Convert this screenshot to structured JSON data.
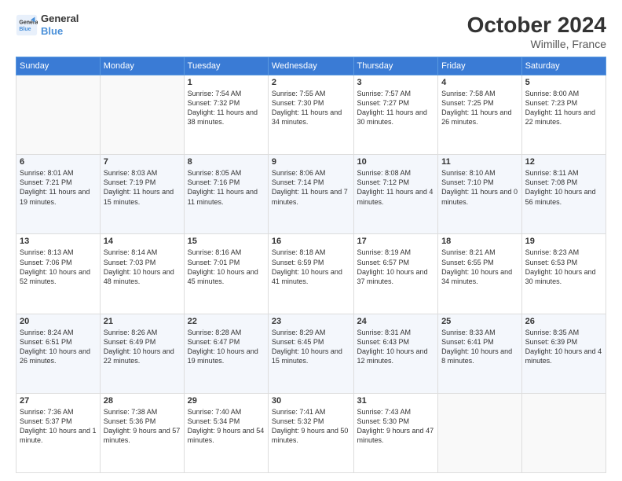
{
  "logo": {
    "line1": "General",
    "line2": "Blue"
  },
  "header": {
    "month": "October 2024",
    "location": "Wimille, France"
  },
  "weekdays": [
    "Sunday",
    "Monday",
    "Tuesday",
    "Wednesday",
    "Thursday",
    "Friday",
    "Saturday"
  ],
  "weeks": [
    [
      {
        "day": "",
        "info": ""
      },
      {
        "day": "",
        "info": ""
      },
      {
        "day": "1",
        "info": "Sunrise: 7:54 AM\nSunset: 7:32 PM\nDaylight: 11 hours\nand 38 minutes."
      },
      {
        "day": "2",
        "info": "Sunrise: 7:55 AM\nSunset: 7:30 PM\nDaylight: 11 hours\nand 34 minutes."
      },
      {
        "day": "3",
        "info": "Sunrise: 7:57 AM\nSunset: 7:27 PM\nDaylight: 11 hours\nand 30 minutes."
      },
      {
        "day": "4",
        "info": "Sunrise: 7:58 AM\nSunset: 7:25 PM\nDaylight: 11 hours\nand 26 minutes."
      },
      {
        "day": "5",
        "info": "Sunrise: 8:00 AM\nSunset: 7:23 PM\nDaylight: 11 hours\nand 22 minutes."
      }
    ],
    [
      {
        "day": "6",
        "info": "Sunrise: 8:01 AM\nSunset: 7:21 PM\nDaylight: 11 hours\nand 19 minutes."
      },
      {
        "day": "7",
        "info": "Sunrise: 8:03 AM\nSunset: 7:19 PM\nDaylight: 11 hours\nand 15 minutes."
      },
      {
        "day": "8",
        "info": "Sunrise: 8:05 AM\nSunset: 7:16 PM\nDaylight: 11 hours\nand 11 minutes."
      },
      {
        "day": "9",
        "info": "Sunrise: 8:06 AM\nSunset: 7:14 PM\nDaylight: 11 hours\nand 7 minutes."
      },
      {
        "day": "10",
        "info": "Sunrise: 8:08 AM\nSunset: 7:12 PM\nDaylight: 11 hours\nand 4 minutes."
      },
      {
        "day": "11",
        "info": "Sunrise: 8:10 AM\nSunset: 7:10 PM\nDaylight: 11 hours\nand 0 minutes."
      },
      {
        "day": "12",
        "info": "Sunrise: 8:11 AM\nSunset: 7:08 PM\nDaylight: 10 hours\nand 56 minutes."
      }
    ],
    [
      {
        "day": "13",
        "info": "Sunrise: 8:13 AM\nSunset: 7:06 PM\nDaylight: 10 hours\nand 52 minutes."
      },
      {
        "day": "14",
        "info": "Sunrise: 8:14 AM\nSunset: 7:03 PM\nDaylight: 10 hours\nand 48 minutes."
      },
      {
        "day": "15",
        "info": "Sunrise: 8:16 AM\nSunset: 7:01 PM\nDaylight: 10 hours\nand 45 minutes."
      },
      {
        "day": "16",
        "info": "Sunrise: 8:18 AM\nSunset: 6:59 PM\nDaylight: 10 hours\nand 41 minutes."
      },
      {
        "day": "17",
        "info": "Sunrise: 8:19 AM\nSunset: 6:57 PM\nDaylight: 10 hours\nand 37 minutes."
      },
      {
        "day": "18",
        "info": "Sunrise: 8:21 AM\nSunset: 6:55 PM\nDaylight: 10 hours\nand 34 minutes."
      },
      {
        "day": "19",
        "info": "Sunrise: 8:23 AM\nSunset: 6:53 PM\nDaylight: 10 hours\nand 30 minutes."
      }
    ],
    [
      {
        "day": "20",
        "info": "Sunrise: 8:24 AM\nSunset: 6:51 PM\nDaylight: 10 hours\nand 26 minutes."
      },
      {
        "day": "21",
        "info": "Sunrise: 8:26 AM\nSunset: 6:49 PM\nDaylight: 10 hours\nand 22 minutes."
      },
      {
        "day": "22",
        "info": "Sunrise: 8:28 AM\nSunset: 6:47 PM\nDaylight: 10 hours\nand 19 minutes."
      },
      {
        "day": "23",
        "info": "Sunrise: 8:29 AM\nSunset: 6:45 PM\nDaylight: 10 hours\nand 15 minutes."
      },
      {
        "day": "24",
        "info": "Sunrise: 8:31 AM\nSunset: 6:43 PM\nDaylight: 10 hours\nand 12 minutes."
      },
      {
        "day": "25",
        "info": "Sunrise: 8:33 AM\nSunset: 6:41 PM\nDaylight: 10 hours\nand 8 minutes."
      },
      {
        "day": "26",
        "info": "Sunrise: 8:35 AM\nSunset: 6:39 PM\nDaylight: 10 hours\nand 4 minutes."
      }
    ],
    [
      {
        "day": "27",
        "info": "Sunrise: 7:36 AM\nSunset: 5:37 PM\nDaylight: 10 hours\nand 1 minute."
      },
      {
        "day": "28",
        "info": "Sunrise: 7:38 AM\nSunset: 5:36 PM\nDaylight: 9 hours\nand 57 minutes."
      },
      {
        "day": "29",
        "info": "Sunrise: 7:40 AM\nSunset: 5:34 PM\nDaylight: 9 hours\nand 54 minutes."
      },
      {
        "day": "30",
        "info": "Sunrise: 7:41 AM\nSunset: 5:32 PM\nDaylight: 9 hours\nand 50 minutes."
      },
      {
        "day": "31",
        "info": "Sunrise: 7:43 AM\nSunset: 5:30 PM\nDaylight: 9 hours\nand 47 minutes."
      },
      {
        "day": "",
        "info": ""
      },
      {
        "day": "",
        "info": ""
      }
    ]
  ]
}
